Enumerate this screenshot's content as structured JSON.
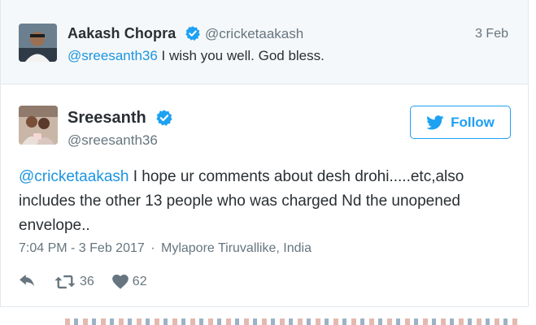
{
  "parent_tweet": {
    "name": "Aakash Chopra",
    "handle": "@cricketaakash",
    "date": "3 Feb",
    "mention": "@sreesanth36",
    "text": " I wish you well. God bless."
  },
  "main_tweet": {
    "name": "Sreesanth",
    "handle": "@sreesanth36",
    "follow_label": "Follow",
    "mention": "@cricketaakash",
    "line1_rest": " I hope ur comments about desh drohi.....etc,also",
    "line2": "includes the other 13 people who was charged Nd the unopened",
    "line3": "envelope..",
    "time": "7:04 PM - 3 Feb 2017",
    "separator": "·",
    "location": "Mylapore Tiruvallike, India",
    "retweet_count": "36",
    "like_count": "62"
  },
  "colors": {
    "accent": "#1da1f2",
    "link": "#1b95e0",
    "secondary_text": "#66757f",
    "parent_background": "#f5f8fa"
  },
  "icons": {
    "verified": "verified-badge-icon",
    "follow": "twitter-bird-icon",
    "reply": "reply-icon",
    "retweet": "retweet-icon",
    "like": "heart-icon"
  }
}
